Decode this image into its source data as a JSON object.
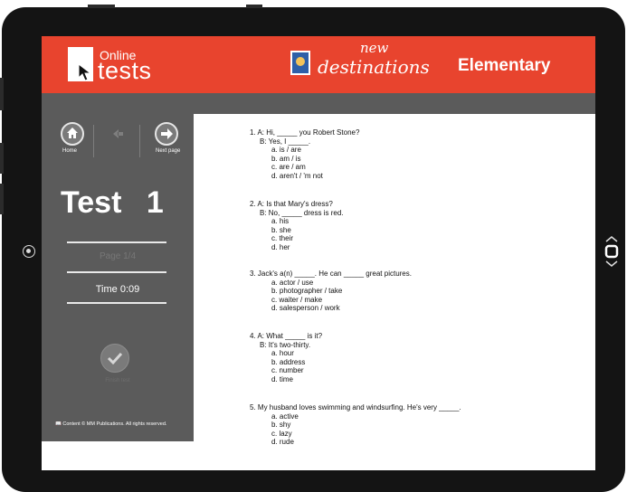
{
  "header": {
    "logo_online": "Online",
    "logo_tests": "tests",
    "brand_new": "new",
    "brand_destinations": "destinations",
    "level": "Elementary"
  },
  "nav": {
    "home_label": "Home",
    "next_label": "Next page"
  },
  "test": {
    "title": "Test 1",
    "page": "Page 1/4",
    "time": "Time 0:09",
    "finish": "Finish test"
  },
  "footer": {
    "copyright": "Content © MM Publications. All rights reserved."
  },
  "questions": [
    {
      "number": "1.",
      "lines": [
        "A: Hi, _____ you Robert Stone?",
        "B: Yes, I _____."
      ],
      "options": [
        "a. is / are",
        "b. am / is",
        "c. are / am",
        "d. aren't / 'm not"
      ]
    },
    {
      "number": "2.",
      "lines": [
        "A: Is that Mary's dress?",
        "B: No, _____ dress is red."
      ],
      "options": [
        "a. his",
        "b. she",
        "c. their",
        "d. her"
      ]
    },
    {
      "number": "3.",
      "lines": [
        "Jack's a(n) _____. He can _____ great pictures."
      ],
      "options": [
        "a. actor / use",
        "b. photographer / take",
        "c. waiter / make",
        "d. salesperson / work"
      ]
    },
    {
      "number": "4.",
      "lines": [
        "A: What _____ is it?",
        "B: It's two-thirty."
      ],
      "options": [
        "a. hour",
        "b. address",
        "c. number",
        "d. time"
      ]
    },
    {
      "number": "5.",
      "lines": [
        "My husband loves swimming and windsurfing. He's very _____."
      ],
      "options": [
        "a. active",
        "b. shy",
        "c. lazy",
        "d. rude"
      ]
    }
  ],
  "colors": {
    "header_red": "#e8442e",
    "sidebar_gray": "#5b5b5b",
    "device_black": "#141414"
  }
}
